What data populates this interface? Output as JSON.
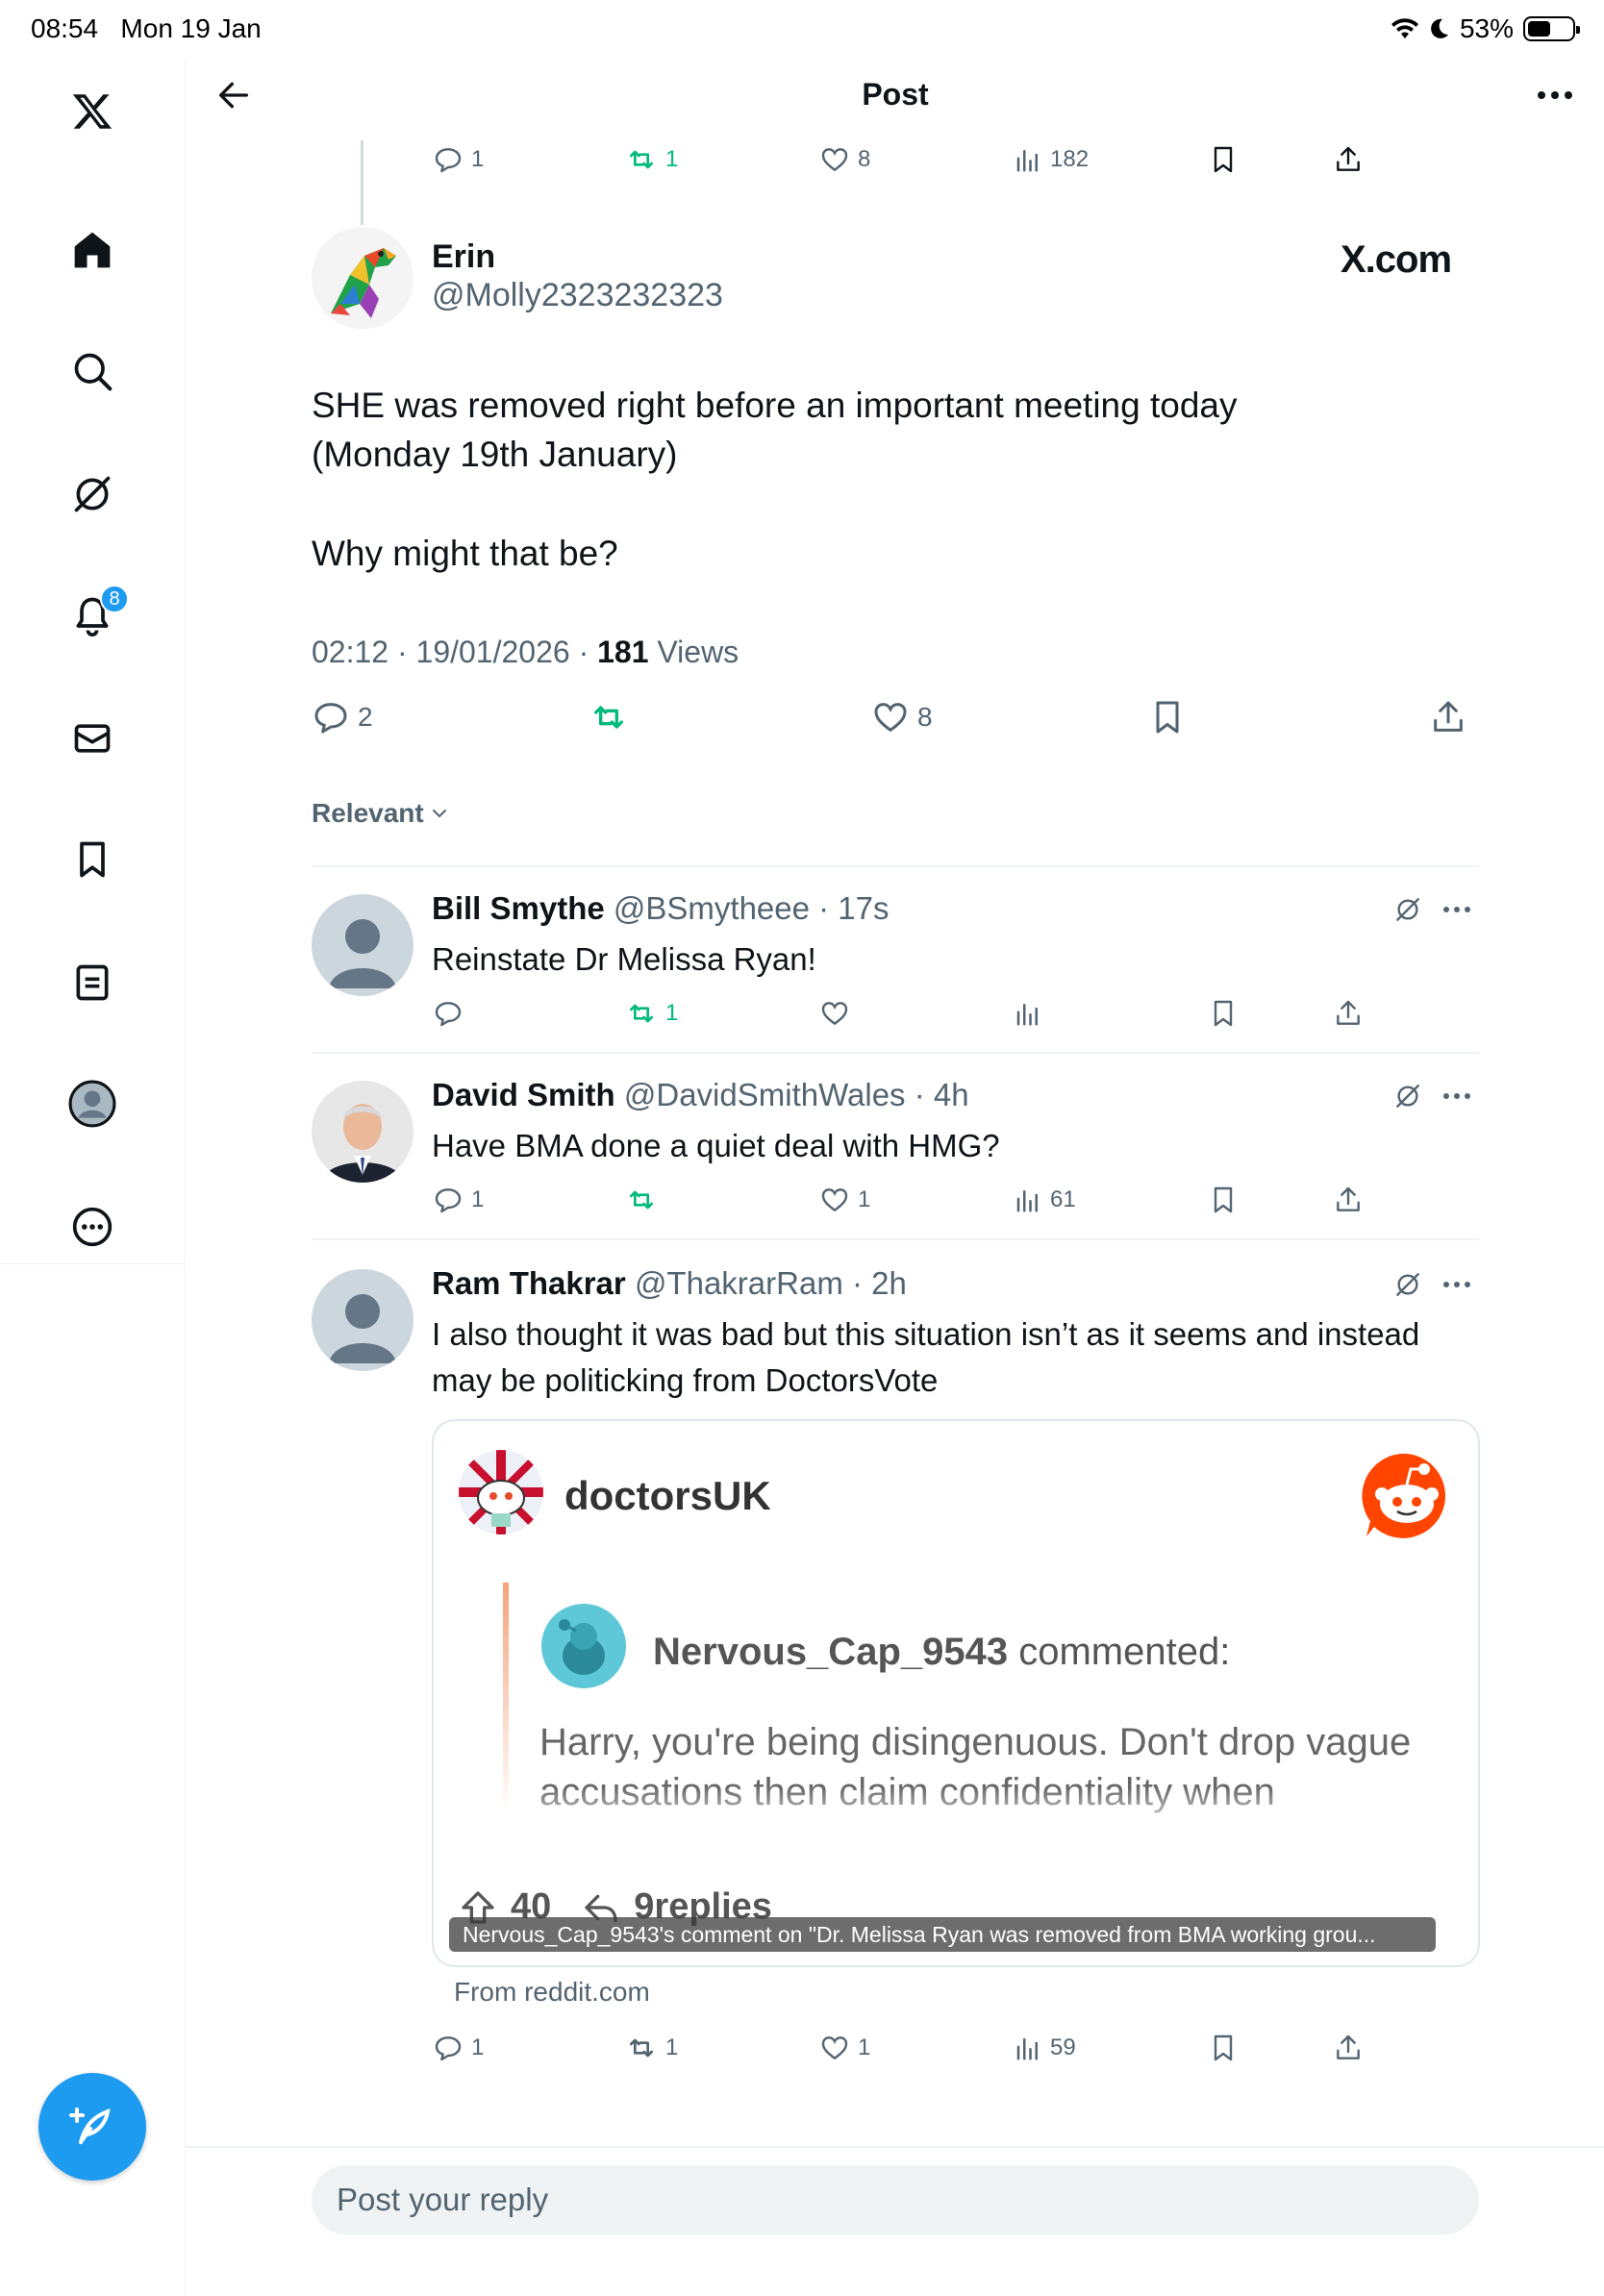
{
  "status_bar": {
    "time": "08:54",
    "date": "Mon 19 Jan",
    "battery_percent": "53%",
    "battery_level": 0.53,
    "icons": [
      "wifi-icon",
      "moon-icon",
      "battery-icon"
    ]
  },
  "sidebar": {
    "items": [
      {
        "name": "x-logo-icon"
      },
      {
        "name": "home-icon"
      },
      {
        "name": "search-icon"
      },
      {
        "name": "grok-icon"
      },
      {
        "name": "notifications-icon",
        "badge": "8"
      },
      {
        "name": "messages-icon"
      },
      {
        "name": "bookmarks-icon"
      },
      {
        "name": "lists-icon"
      },
      {
        "name": "profile-icon"
      },
      {
        "name": "more-icon"
      }
    ],
    "compose_icon": "compose-icon"
  },
  "header": {
    "title": "Post"
  },
  "parent_tweet_actions": {
    "replies": "1",
    "reposts": "1",
    "likes": "8",
    "views": "182"
  },
  "main_tweet": {
    "name": "Erin",
    "handle": "@Molly2323232323",
    "source": "X.com",
    "text_line1": "SHE was removed right before an important meeting today (Monday 19th January)",
    "text_line2": "Why might that be?",
    "time": "02:12 · 19/01/2026 · ",
    "views_count": "181",
    "views_label": " Views",
    "actions": {
      "replies": "2",
      "likes": "8"
    }
  },
  "sort_label": "Relevant",
  "replies": [
    {
      "name": "Bill Smythe",
      "handle": "@BSmytheee",
      "time": " · 17s",
      "text": "Reinstate Dr Melissa Ryan!",
      "reposts": "1"
    },
    {
      "name": "David Smith",
      "handle": "@DavidSmithWales",
      "time": " · 4h",
      "text": "Have BMA done a quiet deal with HMG?",
      "replies": "1",
      "likes": "1",
      "views": "61"
    },
    {
      "name": "Ram Thakrar",
      "handle": "@ThakrarRam",
      "time": " · 2h",
      "text": "I also thought it was bad but this situation isn’t as it seems and instead may be politicking from DoctorsVote",
      "card": {
        "subreddit": "doctorsUK",
        "commenter": "Nervous_Cap_9543",
        "commented_label": "commented:",
        "comment": "Harry, you're being disingenuous. Don't drop vague accusations then claim confidentiality when",
        "upvotes": "40",
        "replies_label": "9replies",
        "caption": "Nervous_Cap_9543's comment on \"Dr. Melissa Ryan was removed from BMA working grou...",
        "from": "From reddit.com"
      },
      "replies": "1",
      "reposts": "1",
      "likes": "1",
      "views": "59"
    }
  ],
  "reply_input": {
    "placeholder": "Post your reply"
  },
  "colors": {
    "accent": "#1d9bf0",
    "repost_green": "#00ba7c",
    "secondary_text": "#536471",
    "reddit_orange": "#ff4500"
  }
}
